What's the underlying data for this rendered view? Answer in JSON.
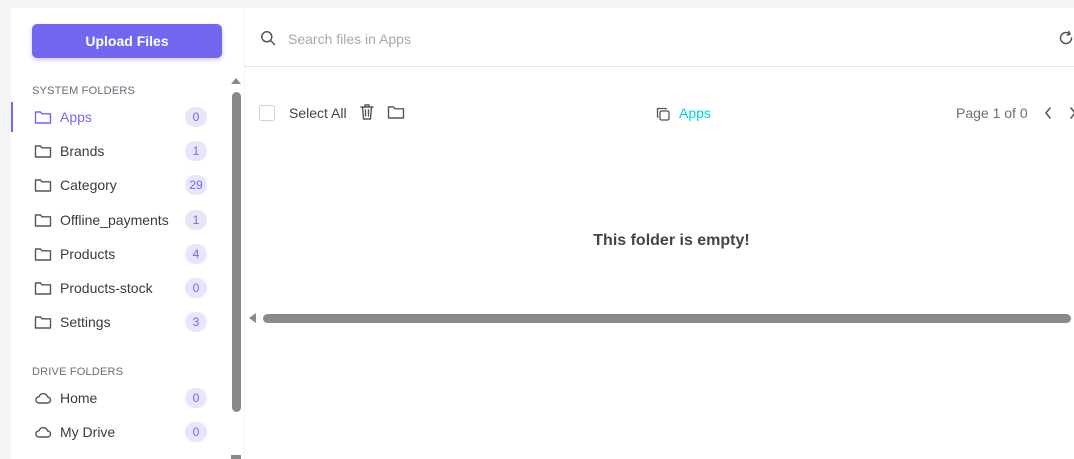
{
  "sidebar": {
    "upload_label": "Upload Files",
    "system_section": "SYSTEM FOLDERS",
    "system_folders": [
      {
        "label": "Apps",
        "count": "0"
      },
      {
        "label": "Brands",
        "count": "1"
      },
      {
        "label": "Category",
        "count": "29"
      },
      {
        "label": "Offline_payments",
        "count": "1"
      },
      {
        "label": "Products",
        "count": "4"
      },
      {
        "label": "Products-stock",
        "count": "0"
      },
      {
        "label": "Settings",
        "count": "3"
      }
    ],
    "drive_section": "DRIVE FOLDERS",
    "drive_folders": [
      {
        "label": "Home",
        "count": "0"
      },
      {
        "label": "My Drive",
        "count": "0"
      }
    ]
  },
  "search": {
    "placeholder": "Search files in Apps",
    "value": ""
  },
  "toolbar": {
    "select_all": "Select All",
    "breadcrumb": "Apps",
    "page_info": "Page 1 of 0"
  },
  "content": {
    "empty_message": "This folder is empty!"
  },
  "colors": {
    "accent": "#7367f0",
    "breadcrumb": "#00cfe8",
    "badge_bg": "#e7e6fb"
  }
}
